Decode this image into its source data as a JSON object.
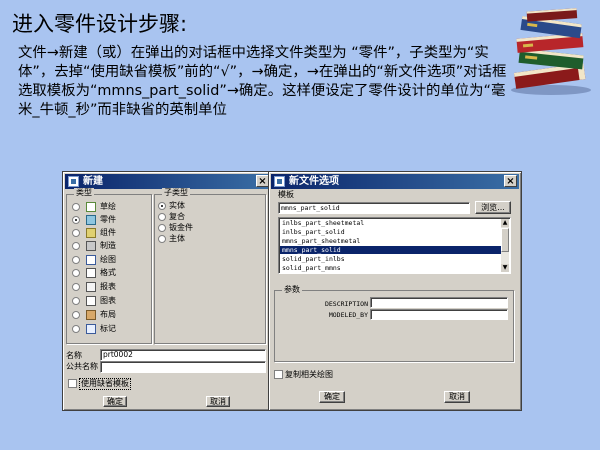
{
  "slide": {
    "title": "进入零件设计步骤:",
    "body": "文件→新建（或）在弹出的对话框中选择文件类型为 “零件”，子类型为“实体”，去掉“使用缺省模板”前的“√”，→确定，→在弹出的“新文件选项”对话框选取模板为“mmns_part_solid”→确定。这样便设定了零件设计的单位为“毫米_牛顿_秒”而非缺省的英制单位"
  },
  "new_dialog": {
    "title": "新建",
    "close_label": "×",
    "type_group_label": "类型",
    "subtype_group_label": "子类型",
    "types": [
      {
        "label": "草绘",
        "selected": false
      },
      {
        "label": "零件",
        "selected": true
      },
      {
        "label": "组件",
        "selected": false
      },
      {
        "label": "制造",
        "selected": false
      },
      {
        "label": "绘图",
        "selected": false
      },
      {
        "label": "格式",
        "selected": false
      },
      {
        "label": "报表",
        "selected": false
      },
      {
        "label": "图表",
        "selected": false
      },
      {
        "label": "布局",
        "selected": false
      },
      {
        "label": "标记",
        "selected": false
      }
    ],
    "subtypes": [
      {
        "label": "实体",
        "selected": true
      },
      {
        "label": "复合",
        "selected": false
      },
      {
        "label": "钣金件",
        "selected": false
      },
      {
        "label": "主体",
        "selected": false
      }
    ],
    "name_label": "名称",
    "name_value": "prt0002",
    "common_name_label": "公共名称",
    "common_name_value": "",
    "use_default_template_label": "使用缺省模板",
    "use_default_template_checked": false,
    "ok_label": "确定",
    "cancel_label": "取消"
  },
  "options_dialog": {
    "title": "新文件选项",
    "close_label": "×",
    "template_label": "模板",
    "template_value": "mmns_part_solid",
    "browse_label": "浏览...",
    "templates": [
      {
        "label": "inlbs_part_sheetmetal",
        "selected": false
      },
      {
        "label": "inlbs_part_solid",
        "selected": false
      },
      {
        "label": "mmns_part_sheetmetal",
        "selected": false
      },
      {
        "label": "mmns_part_solid",
        "selected": true
      },
      {
        "label": "solid_part_inlbs",
        "selected": false
      },
      {
        "label": "solid_part_mmns",
        "selected": false
      }
    ],
    "params_label": "参数",
    "params": [
      {
        "name": "DESCRIPTION",
        "value": ""
      },
      {
        "name": "MODELED_BY",
        "value": ""
      }
    ],
    "copy_drawings_label": "复制相关绘图",
    "copy_drawings_checked": false,
    "ok_label": "确定",
    "cancel_label": "取消"
  }
}
